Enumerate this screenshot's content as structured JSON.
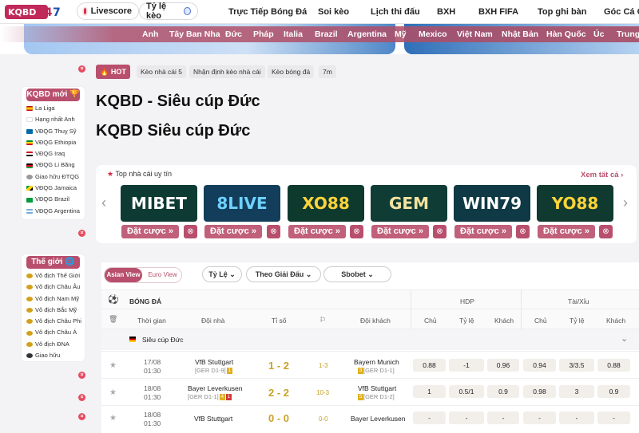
{
  "header": {
    "logo": "KQBD247",
    "livescore": "Livescore",
    "odds": "Tỷ lệ kèo",
    "nav": [
      "Trực Tiếp Bóng Đá",
      "Soi kèo",
      "Lịch thi đấu",
      "BXH",
      "BXH FIFA",
      "Top ghi bàn",
      "Góc Cá Cư"
    ]
  },
  "countries": [
    "Anh",
    "Tây Ban Nha",
    "Đức",
    "Pháp",
    "Italia",
    "Brazil",
    "Argentina",
    "Mỹ",
    "Mexico",
    "Việt Nam",
    "Nhật Bản",
    "Hàn Quốc",
    "Úc",
    "Trung Q"
  ],
  "sidebar": {
    "new_title": "KQBD mới",
    "new_items": [
      "La Liga",
      "Hạng nhất Anh",
      "VĐQG Thuỵ Sỹ",
      "VĐQG Ethiopia",
      "VĐQG Iraq",
      "VĐQG Li Băng",
      "Giao hữu ĐTQG",
      "VĐQG Jamaica",
      "VĐQG Brazil",
      "VĐQG Argentina"
    ],
    "world_title": "Thế giới",
    "world_items": [
      "Vô địch Thế Giới",
      "Vô địch Châu Âu",
      "Vô địch Nam Mỹ",
      "Vô địch Bắc Mỹ",
      "Vô địch Châu Phi",
      "Vô địch Châu Á",
      "Vô địch ĐNA",
      "Giao hữu"
    ]
  },
  "tags": {
    "hot": "HOT",
    "items": [
      "Kèo nhà cái 5",
      "Nhận định kèo nhà cái",
      "Kèo bóng đá",
      "7m"
    ]
  },
  "title1": "KQBD - Siêu cúp Đức",
  "title2": "KQBD Siêu cúp Đức",
  "bookmakers": {
    "title": "Top nhà cái uy tín",
    "see_all": "Xem tất cả",
    "names": [
      "MIBET",
      "8LIVE",
      "XO88",
      "GEM",
      "WIN79",
      "YO88"
    ],
    "bet_label": "Đặt cược"
  },
  "table": {
    "view_asian": "Asian View",
    "view_euro": "Euro View",
    "filter1": "Tỷ Lệ",
    "filter2": "Theo Giải Đấu",
    "filter3": "Sbobet",
    "sport": "BÓNG ĐÁ",
    "hdp": "HDP",
    "taixiu": "Tài/Xỉu",
    "cols": [
      "Thời gian",
      "Đội nhà",
      "Tỉ số",
      "Đội khách",
      "Chủ",
      "Tỷ lệ",
      "Khách",
      "Chủ",
      "Tỷ lệ",
      "Khách"
    ],
    "league": "Siêu cúp Đức",
    "matches": [
      {
        "date": "17/08",
        "time": "01:30",
        "home": "VfB Stuttgart",
        "home_sub": "[GER D1-9]",
        "home_badge": "1",
        "score": "1 - 2",
        "hdp": "1-3",
        "away": "Bayern Munich",
        "away_sub": "[GER D1-1]",
        "away_badge": "3",
        "odds": [
          "0.88",
          "-1",
          "0.96",
          "0.94",
          "3/3.5",
          "0.88"
        ]
      },
      {
        "date": "18/08",
        "time": "01:30",
        "home": "Bayer Leverkusen",
        "home_sub": "[GER D1-1]",
        "home_badge": "4",
        "home_badge2": "1",
        "score": "2 - 2",
        "hdp": "10-3",
        "away": "VfB Stuttgart",
        "away_sub": "[GER D1-2]",
        "away_badge": "5",
        "odds": [
          "1",
          "0.5/1",
          "0.9",
          "0.98",
          "3",
          "0.9"
        ]
      },
      {
        "date": "18/08",
        "time": "01:30",
        "home": "VfB Stuttgart",
        "home_sub": "",
        "score": "0 - 0",
        "hdp": "0-0",
        "away": "Bayer Leverkusen",
        "away_sub": "",
        "odds": [
          "-",
          "-",
          "-",
          "-",
          "-",
          "-"
        ]
      }
    ]
  }
}
